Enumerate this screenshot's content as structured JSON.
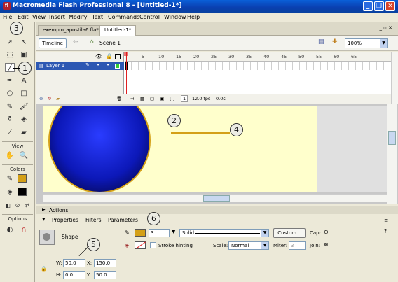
{
  "window": {
    "app_icon": "fl",
    "title": "Macromedia Flash Professional 8 - [Untitled-1*]",
    "min": "_",
    "restore": "❐",
    "close": "✕"
  },
  "menu": [
    "File",
    "Edit",
    "View",
    "Insert",
    "Modify",
    "Text",
    "Commands",
    "Control",
    "Window",
    "Help"
  ],
  "toolbox": {
    "view_label": "View",
    "colors_label": "Colors",
    "options_label": "Options"
  },
  "doc_tabs": [
    "exemplo_apostila6.fla*",
    "Untitled-1*"
  ],
  "timeline_bar": {
    "timeline_button": "Timeline",
    "scene": "Scene 1",
    "zoom": "100%"
  },
  "timeline": {
    "layer_name": "Layer 1",
    "ruler": [
      "5",
      "10",
      "15",
      "20",
      "25",
      "30",
      "35",
      "40",
      "45",
      "50",
      "55",
      "60",
      "65"
    ],
    "frame": "1",
    "fps": "12.0 fps",
    "time": "0.0s"
  },
  "panels": {
    "actions": "Actions",
    "tabs": [
      "Properties",
      "Filters",
      "Parameters"
    ]
  },
  "properties": {
    "type_label": "Shape",
    "stroke_height": "3",
    "stroke_style": "Solid",
    "custom_button": "Custom...",
    "cap_label": "Cap:",
    "stroke_hinting": "Stroke hinting",
    "scale_label": "Scale:",
    "scale_value": "Normal",
    "miter_label": "Miter:",
    "miter_value": "3",
    "join_label": "Join:",
    "w_label": "W:",
    "w_value": "50.0",
    "x_label": "X:",
    "x_value": "150.0",
    "h_label": "H:",
    "h_value": "0.0",
    "y_label": "Y:",
    "y_value": "50.0"
  },
  "callouts": [
    "1",
    "2",
    "3",
    "4",
    "5",
    "6"
  ],
  "colors": {
    "stroke_color": "#d4a017",
    "circle_fill": "#1010d0",
    "stage_bg": "#ffffcc",
    "title_bar": "#0a4fc8"
  }
}
